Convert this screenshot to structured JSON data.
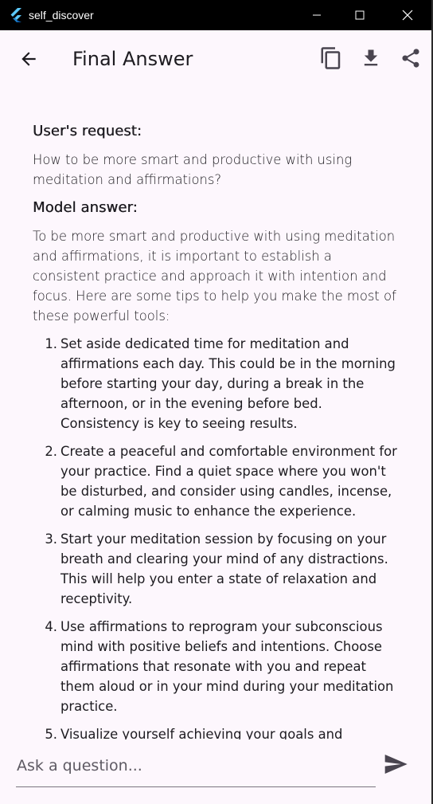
{
  "window": {
    "title": "self_discover",
    "controls": [
      "minimize-icon",
      "maximize-icon",
      "close-icon"
    ]
  },
  "appbar": {
    "title": "Final Answer",
    "back_icon": "arrow-back-icon",
    "actions": [
      "copy-icon",
      "download-icon",
      "share-icon"
    ]
  },
  "content": {
    "request_heading": "User's request:",
    "request_text": "How to be more smart and productive with using meditation and affirmations?",
    "answer_heading": "Model answer:",
    "answer_intro": "To be more smart and productive with using meditation and affirmations, it is important to establish a consistent practice and approach it with intention and focus. Here are some tips to help you make the most of these powerful tools:",
    "answer_items": [
      {
        "num": "1.",
        "text": "Set aside dedicated time for meditation and affirmations each day. This could be in the morning before starting your day, during a break in the afternoon, or in the evening before bed. Consistency is key to seeing results."
      },
      {
        "num": "2.",
        "text": "Create a peaceful and comfortable environment for your practice. Find a quiet space where you won't be disturbed, and consider using candles, incense, or calming music to enhance the experience."
      },
      {
        "num": "3.",
        "text": "Start your meditation session by focusing on your breath and clearing your mind of any distractions. This will help you enter a state of relaxation and receptivity."
      },
      {
        "num": "4.",
        "text": "Use affirmations to reprogram your subconscious mind with positive beliefs and intentions. Choose affirmations that resonate with you and repeat them aloud or in your mind during your meditation practice."
      },
      {
        "num": "5.",
        "text": "Visualize yourself achieving your goals and"
      }
    ]
  },
  "input": {
    "placeholder": "Ask a question...",
    "value": ""
  },
  "colors": {
    "background": "#fdf7fd",
    "titlebar": "#000000",
    "text": "#1d1b20"
  }
}
